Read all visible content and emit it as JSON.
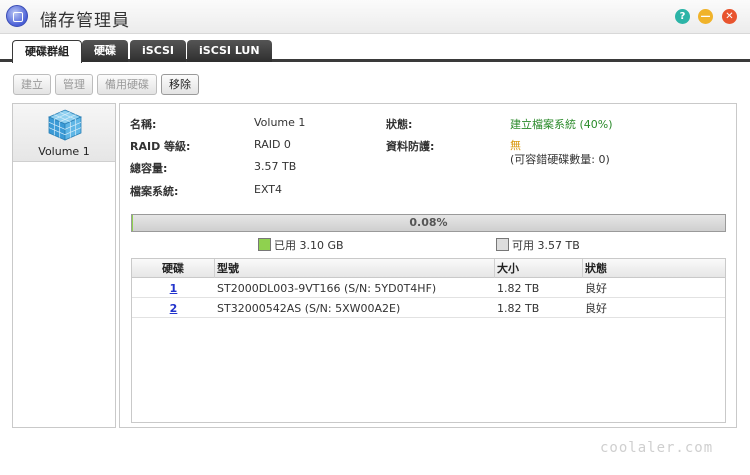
{
  "window": {
    "title": "儲存管理員",
    "help_glyph": "?",
    "min_glyph": "—",
    "close_glyph": "✕"
  },
  "tabs": [
    {
      "label": "硬碟群組"
    },
    {
      "label": "硬碟"
    },
    {
      "label": "iSCSI"
    },
    {
      "label": "iSCSI LUN"
    }
  ],
  "toolbar": {
    "create": "建立",
    "manage": "管理",
    "spare": "備用硬碟",
    "remove": "移除"
  },
  "volumes": [
    {
      "label": "Volume 1"
    }
  ],
  "details": {
    "name_label": "名稱:",
    "name_value": "Volume 1",
    "raid_label": "RAID 等級:",
    "raid_value": "RAID 0",
    "capacity_label": "總容量:",
    "capacity_value": "3.57 TB",
    "fs_label": "檔案系統:",
    "fs_value": "EXT4",
    "status_label": "狀態:",
    "status_value": "建立檔案系統 (40%)",
    "protect_label": "資料防護:",
    "protect_value": "無",
    "protect_note": "(可容錯硬碟數量: 0)"
  },
  "usage": {
    "percent_text": "0.08%",
    "fraction": 0.0008,
    "used_label": "已用 3.10 GB",
    "free_label": "可用 3.57 TB",
    "used_color": "#8fd14f",
    "free_color": "#dddddd"
  },
  "disk_table": {
    "headers": {
      "disk": "硬碟",
      "model": "型號",
      "size": "大小",
      "status": "狀態"
    },
    "rows": [
      {
        "disk": "1",
        "model": "ST2000DL003-9VT166 (S/N: 5YD0T4HF)",
        "size": "1.82 TB",
        "status": "良好"
      },
      {
        "disk": "2",
        "model": "ST32000542AS (S/N: 5XW00A2E)",
        "size": "1.82 TB",
        "status": "良好"
      }
    ]
  },
  "watermark": "coolaler.com"
}
